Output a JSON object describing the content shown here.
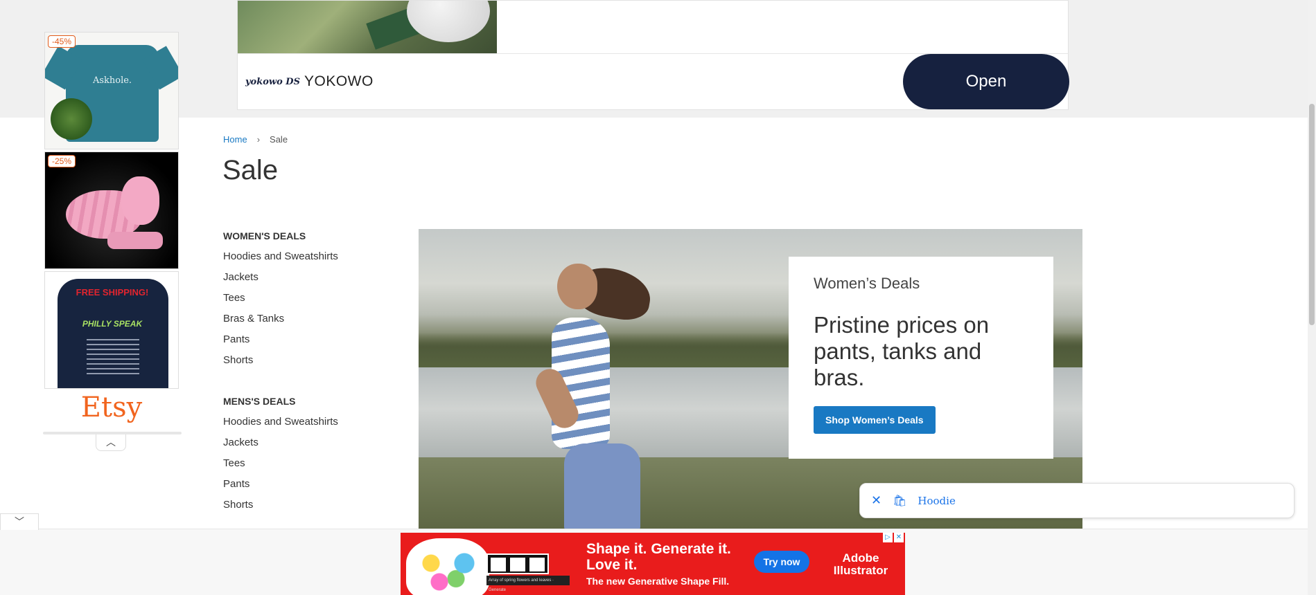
{
  "top_ad": {
    "brand_logo": "yokowo DS",
    "brand": "YOKOWO",
    "cta": "Open"
  },
  "left_ad": {
    "ad_choices": [
      "▷",
      "✕"
    ],
    "tiles": [
      {
        "badge": "-45%",
        "shirt_text": "Askhole."
      },
      {
        "badge": "-25%"
      },
      {
        "headline": "FREE SHIPPING!",
        "sub": "PHILLY SPEAK"
      }
    ],
    "advertiser": "Etsy",
    "collapse_icon": "︿"
  },
  "breadcrumb": {
    "home": "Home",
    "separator": "›",
    "current": "Sale"
  },
  "page": {
    "title": "Sale"
  },
  "sidebar": {
    "groups": [
      {
        "title": "WOMEN'S DEALS",
        "items": [
          "Hoodies and Sweatshirts",
          "Jackets",
          "Tees",
          "Bras & Tanks",
          "Pants",
          "Shorts"
        ]
      },
      {
        "title": "MENS'S DEALS",
        "items": [
          "Hoodies and Sweatshirts",
          "Jackets",
          "Tees",
          "Pants",
          "Shorts"
        ]
      }
    ]
  },
  "hero": {
    "eyebrow": "Women’s Deals",
    "headline": "Pristine prices on pants, tanks and bras.",
    "button": "Shop Women’s Deals"
  },
  "suggestion": {
    "close_icon": "✕",
    "bag_icon": "🛍",
    "term": "Hoodie"
  },
  "bottom_toggle": "﹀",
  "bottom_ad": {
    "headline": "Shape it. Generate it. Love it.",
    "subline": "The new Generative Shape Fill.",
    "prompt_text": "Array of spring flowers and leaves",
    "generate_label": "Generate",
    "cta": "Try now",
    "brand": "Adobe Illustrator",
    "choices": [
      "▷",
      "✕"
    ]
  },
  "colors": {
    "link": "#1979c3",
    "button_primary": "#1979c3",
    "top_ad_cta": "#16213f",
    "bottom_ad_bg": "#e91c1c",
    "etsy_orange": "#f1641e"
  }
}
